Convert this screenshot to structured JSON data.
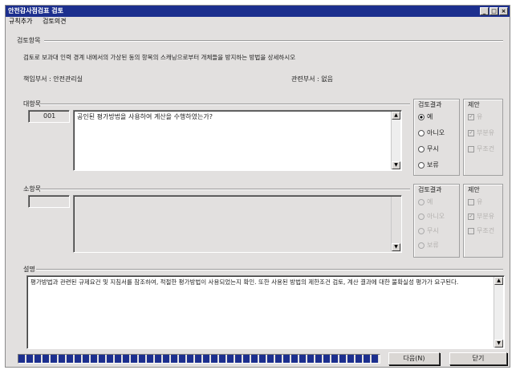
{
  "window": {
    "title": "안전감사점검표 검토",
    "controls": [
      "_",
      "□",
      "×"
    ]
  },
  "menu": [
    "규칙추가",
    "검토의견"
  ],
  "section": {
    "label": "검토항목",
    "instruction": "검토로 보과대 인력 경계 내에서의 가상된 동의 항목의 스캐닝으로부터 개체들을 방지하는 방법을 상세하시오",
    "responsible_dept": "책임부서 : 안전관리실",
    "related_dept": "관련부서 : 없음"
  },
  "major": {
    "label": "대항목",
    "code": "001",
    "question": "공인된 평가방법을 사용하여 계산을 수행하였는가?",
    "result_label": "검토결과",
    "result_options": [
      "예",
      "아니오",
      "무시",
      "보류"
    ],
    "result_selected": 0,
    "proposal_label": "제안",
    "proposal_options": [
      "유",
      "부분유",
      "무조건"
    ]
  },
  "minor": {
    "label": "소항목",
    "code": "",
    "question": "",
    "result_label": "검토결과",
    "result_options": [
      "예",
      "아니오",
      "무시",
      "보류"
    ],
    "proposal_label": "제안",
    "proposal_options": [
      "유",
      "부분유",
      "무조건"
    ]
  },
  "description": {
    "label": "설명",
    "text": "평가방법과 관련된 규제요건 및 지침서를 참조하여, 적절한 평가방법이 사용되었는지 확인. 또한 사용된 방법의 제한조건 검토, 계산 결과에 대한 불확실성 평가가 요구된다."
  },
  "progress": {
    "value": 1.0
  },
  "buttons": {
    "next": "다음(N)",
    "close": "닫기"
  }
}
